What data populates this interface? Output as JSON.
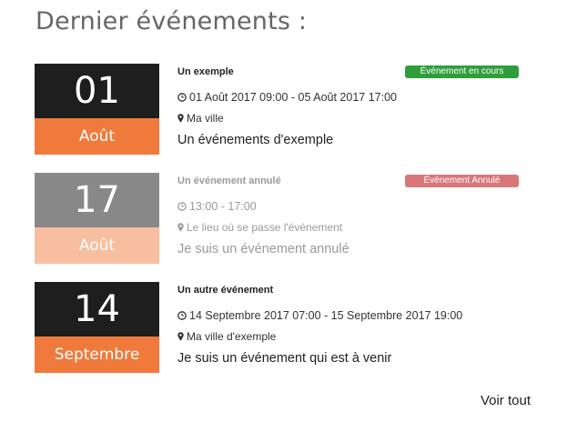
{
  "header": {
    "title": "Dernier événements :"
  },
  "events": [
    {
      "day": "01",
      "month": "Août",
      "title": "Un exemple",
      "badge": "Événement en cours",
      "time": "01 Août 2017 09:00 - 05 Août 2017 17:00",
      "place": "Ma ville",
      "description": "Un événements d'exemple"
    },
    {
      "day": "17",
      "month": "Août",
      "title": "Un événement annulé",
      "badge": "Événement Annulé",
      "time": "13:00 - 17:00",
      "place": "Le lieu où se passe l'événement",
      "description": "Je suis un événement annulé"
    },
    {
      "day": "14",
      "month": "Septembre",
      "title": "Un autre événement",
      "time": "14 Septembre 2017 07:00 - 15 Septembre 2017 19:00",
      "place": "Ma ville d'exemple",
      "description": "Je suis un événement qui est à venir"
    }
  ],
  "footer": {
    "see_all": "Voir tout"
  },
  "colors": {
    "day_bg": "#1e1e1e",
    "month_bg": "#f07a3c",
    "cancelled_day_bg": "#888888",
    "cancelled_month_bg": "#f8bea0",
    "badge_ongoing": "#2f9e3a",
    "badge_cancelled": "#d9767a"
  }
}
